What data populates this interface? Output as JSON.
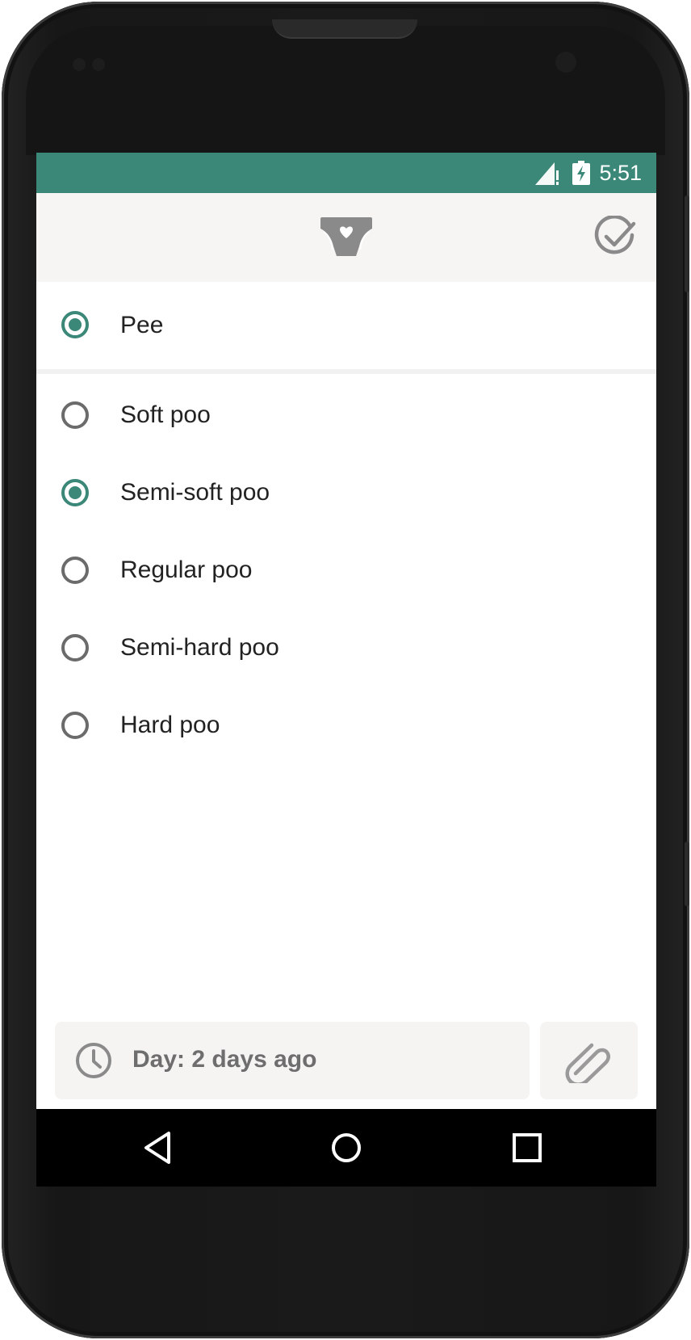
{
  "status_bar": {
    "time": "5:51",
    "background_color": "#3b8778",
    "icons": [
      "signal-icon",
      "battery-charging-icon"
    ]
  },
  "app_bar": {
    "logo_icon": "diaper-heart-icon",
    "confirm_icon": "check-circle-icon"
  },
  "options": {
    "pee": {
      "label": "Pee",
      "checked": true
    },
    "poo_types": [
      {
        "label": "Soft poo",
        "checked": false
      },
      {
        "label": "Semi-soft poo",
        "checked": true
      },
      {
        "label": "Regular poo",
        "checked": false
      },
      {
        "label": "Semi-hard poo",
        "checked": false
      },
      {
        "label": "Hard poo",
        "checked": false
      }
    ]
  },
  "footer": {
    "day_label": "Day: 2 days ago",
    "clock_icon": "clock-icon",
    "attach_icon": "paperclip-icon"
  },
  "nav_bar": {
    "buttons": [
      "back-icon",
      "home-icon",
      "recents-icon"
    ]
  },
  "colors": {
    "accent": "#3b8778",
    "radio_unchecked": "#6b6b6b",
    "app_bar_bg": "#f6f5f4"
  }
}
